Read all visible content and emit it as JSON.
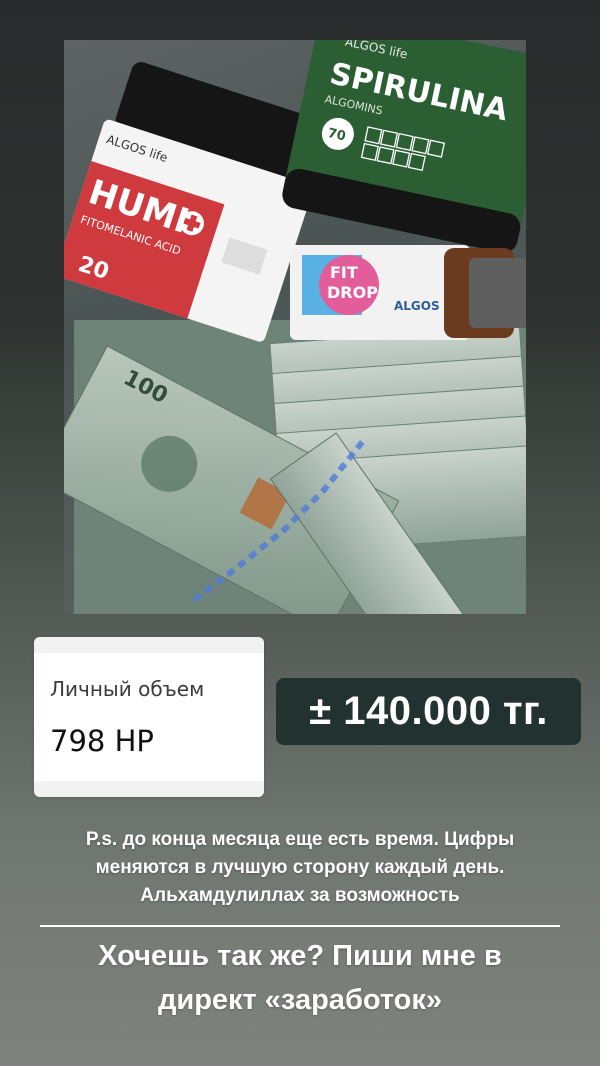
{
  "photo": {
    "products": {
      "humi_brand": "ALGOS life",
      "humi_name": "HUMI",
      "humi_sub": "FITOMELANIC ACID",
      "humi_count": "20",
      "spirulina_brand": "ALGOS life",
      "spirulina_name": "SPIRULINA",
      "spirulina_sub": "ALGOMINS",
      "spirulina_count": "70",
      "fitdrops_brand": "ALGOS",
      "fitdrops_name": "FIT DROPS"
    },
    "banknote_value": "100"
  },
  "stat_card": {
    "label": "Личный объем",
    "value": "798 HP"
  },
  "amount": "± 140.000 тг.",
  "ps_lines": [
    "P.s. до конца месяца еще есть время. Цифры",
    "меняются в лучшую сторону каждый день.",
    "Альхамдулиллах за возможность"
  ],
  "cta_lines": [
    "Хочешь так же? Пиши мне в",
    "директ «заработок»"
  ],
  "colors": {
    "amount_bg": "#223230",
    "humi_red": "#d23a3e",
    "spirulina_green": "#2d6a35",
    "banknote_green": "#8ea79a"
  }
}
